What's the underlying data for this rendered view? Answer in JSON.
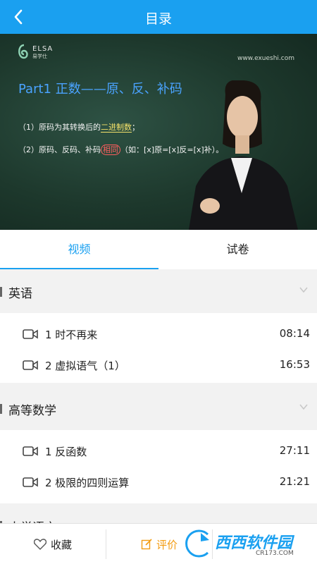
{
  "header": {
    "title": "目录"
  },
  "video": {
    "logo_text": "ELSA",
    "logo_sub": "易学仕",
    "site": "www.exueshi.com",
    "headline": "Part1 正数——原、反、补码",
    "line1_prefix": "（1）原码为其转换后的",
    "line1_highlight": "二进制数",
    "line1_suffix": "；",
    "line2_prefix": "（2）原码、反码、补码",
    "line2_circle": "相同",
    "line2_suffix": "（如：[x]原=[x]反=[x]补）。"
  },
  "tabs": [
    {
      "label": "视频"
    },
    {
      "label": "试卷"
    }
  ],
  "sections": [
    {
      "name": "英语",
      "lessons": [
        {
          "title": "1 时不再来",
          "duration": "08:14"
        },
        {
          "title": "2 虚拟语气（1）",
          "duration": "16:53"
        }
      ]
    },
    {
      "name": "高等数学",
      "lessons": [
        {
          "title": "1 反函数",
          "duration": "27:11"
        },
        {
          "title": "2 极限的四则运算",
          "duration": "21:21"
        }
      ]
    },
    {
      "name": "大学语文"
    }
  ],
  "bottom": {
    "favorite": "收藏",
    "review": "评价"
  },
  "watermark": {
    "text": "西西软件园",
    "site": "CR173.COM"
  },
  "colors": {
    "primary": "#1aa0f0",
    "review": "#f39c12"
  }
}
